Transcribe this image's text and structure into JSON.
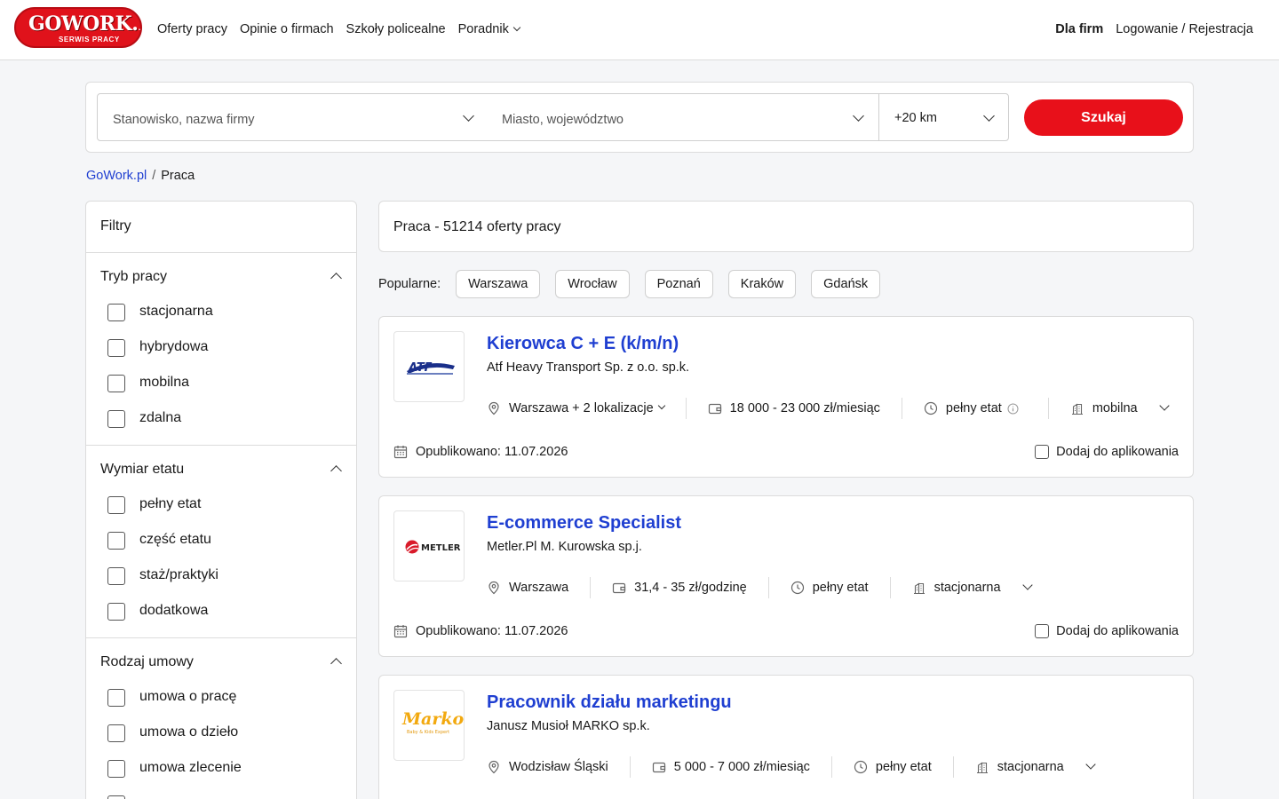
{
  "header": {
    "logo_main": "GOWORK.PL",
    "logo_sub": "SERWIS PRACY",
    "nav": [
      "Oferty pracy",
      "Opinie o firmach",
      "Szkoły policealne",
      "Poradnik"
    ],
    "for_companies": "Dla firm",
    "login": "Logowanie / Rejestracja"
  },
  "search": {
    "position_placeholder": "Stanowisko, nazwa firmy",
    "location_placeholder": "Miasto, województwo",
    "radius": "+20 km",
    "button": "Szukaj"
  },
  "breadcrumb": {
    "home": "GoWork.pl",
    "separator": "/",
    "current": "Praca"
  },
  "sidebar": {
    "title": "Filtry",
    "sections": [
      {
        "title": "Tryb pracy",
        "options": [
          "stacjonarna",
          "hybrydowa",
          "mobilna",
          "zdalna"
        ]
      },
      {
        "title": "Wymiar etatu",
        "options": [
          "pełny etat",
          "część etatu",
          "staż/praktyki",
          "dodatkowa"
        ]
      },
      {
        "title": "Rodzaj umowy",
        "options": [
          "umowa o pracę",
          "umowa o dzieło",
          "umowa zlecenie",
          ""
        ]
      }
    ]
  },
  "results": {
    "title": "Praca - 51214 oferty pracy",
    "popular_label": "Popularne:",
    "popular": [
      "Warszawa",
      "Wrocław",
      "Poznań",
      "Kraków",
      "Gdańsk"
    ]
  },
  "jobs": [
    {
      "title": "Kierowca C + E (k/m/n)",
      "company": "Atf Heavy Transport Sp. z o.o. sp.k.",
      "location": "Warszawa + 2 lokalizacje",
      "salary": "18 000 - 23 000 zł/miesiąc",
      "schedule": "pełny etat",
      "mode": "mobilna",
      "published": "Opublikowano: 11.07.2026",
      "apply": "Dodaj do aplikowania",
      "logo_text": "ATF"
    },
    {
      "title": "E-commerce Specialist",
      "company": "Metler.Pl M. Kurowska sp.j.",
      "location": "Warszawa",
      "salary": "31,4 - 35 zł/godzinę",
      "schedule": "pełny etat",
      "mode": "stacjonarna",
      "published": "Opublikowano: 11.07.2026",
      "apply": "Dodaj do aplikowania",
      "logo_text": "METLER"
    },
    {
      "title": "Pracownik działu marketingu",
      "company": "Janusz Musioł MARKO sp.k.",
      "location": "Wodzisław Śląski",
      "salary": "5 000 - 7 000 zł/miesiąc",
      "schedule": "pełny etat",
      "mode": "stacjonarna",
      "logo_text": "Marko",
      "logo_sub": "Baby & Kids Expert"
    }
  ],
  "colors": {
    "brand_red": "#e8101a",
    "link_blue": "#1f3fd1"
  }
}
